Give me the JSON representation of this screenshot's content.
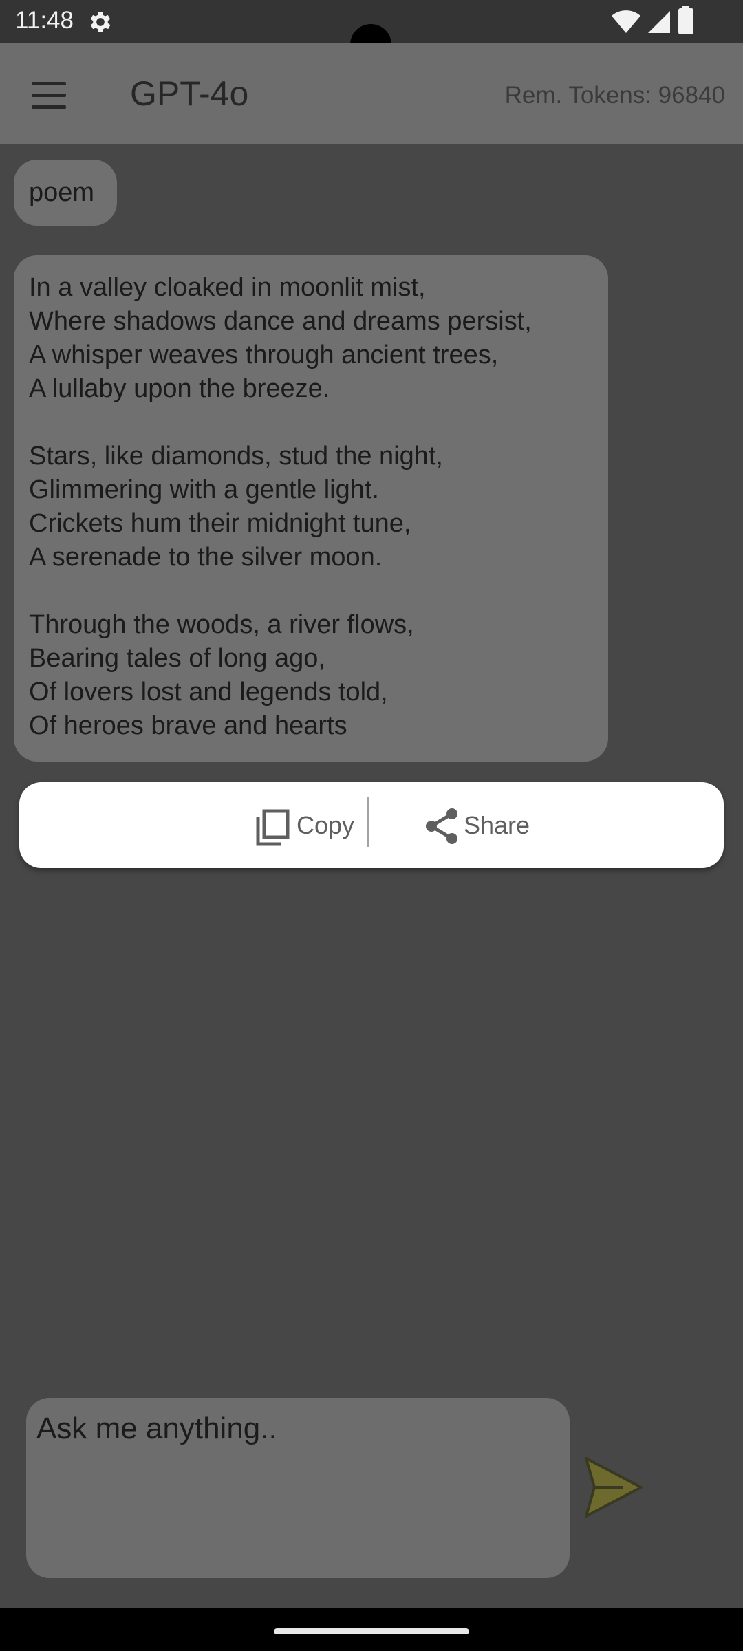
{
  "status_bar": {
    "time": "11:48",
    "icons": [
      "gear-icon",
      "wifi-icon",
      "signal-icon",
      "battery-icon"
    ]
  },
  "app_bar": {
    "menu_icon": "hamburger-menu-icon",
    "title": "GPT-4o",
    "tokens": "Rem. Tokens: 96840"
  },
  "messages": {
    "user": "poem",
    "assistant_lines": [
      "In a valley cloaked in moonlit mist,",
      "Where shadows dance and dreams persist,",
      "A whisper weaves through ancient trees,",
      "A lullaby upon the breeze.",
      "",
      "Stars, like diamonds, stud the night,",
      "Glimmering with a gentle light.",
      "Crickets hum their midnight tune,",
      "A serenade to the silver moon.",
      "",
      "Through the woods, a river flows,",
      "Bearing tales of long ago,",
      "Of lovers lost and legends told,",
      "Of heroes brave and hearts"
    ]
  },
  "popup": {
    "copy_label": "Copy",
    "share_label": "Share",
    "copy_icon": "copy-icon",
    "share_icon": "share-icon"
  },
  "input": {
    "placeholder": "Ask me anything..",
    "value": ""
  },
  "send_icon": "send-icon",
  "colors": {
    "background": "#474747",
    "status_bar": "#343434",
    "app_bar": "#6d6d6d",
    "bubble": "#707070",
    "popup": "#ffffff",
    "send_accent": "#6e6a2e"
  }
}
